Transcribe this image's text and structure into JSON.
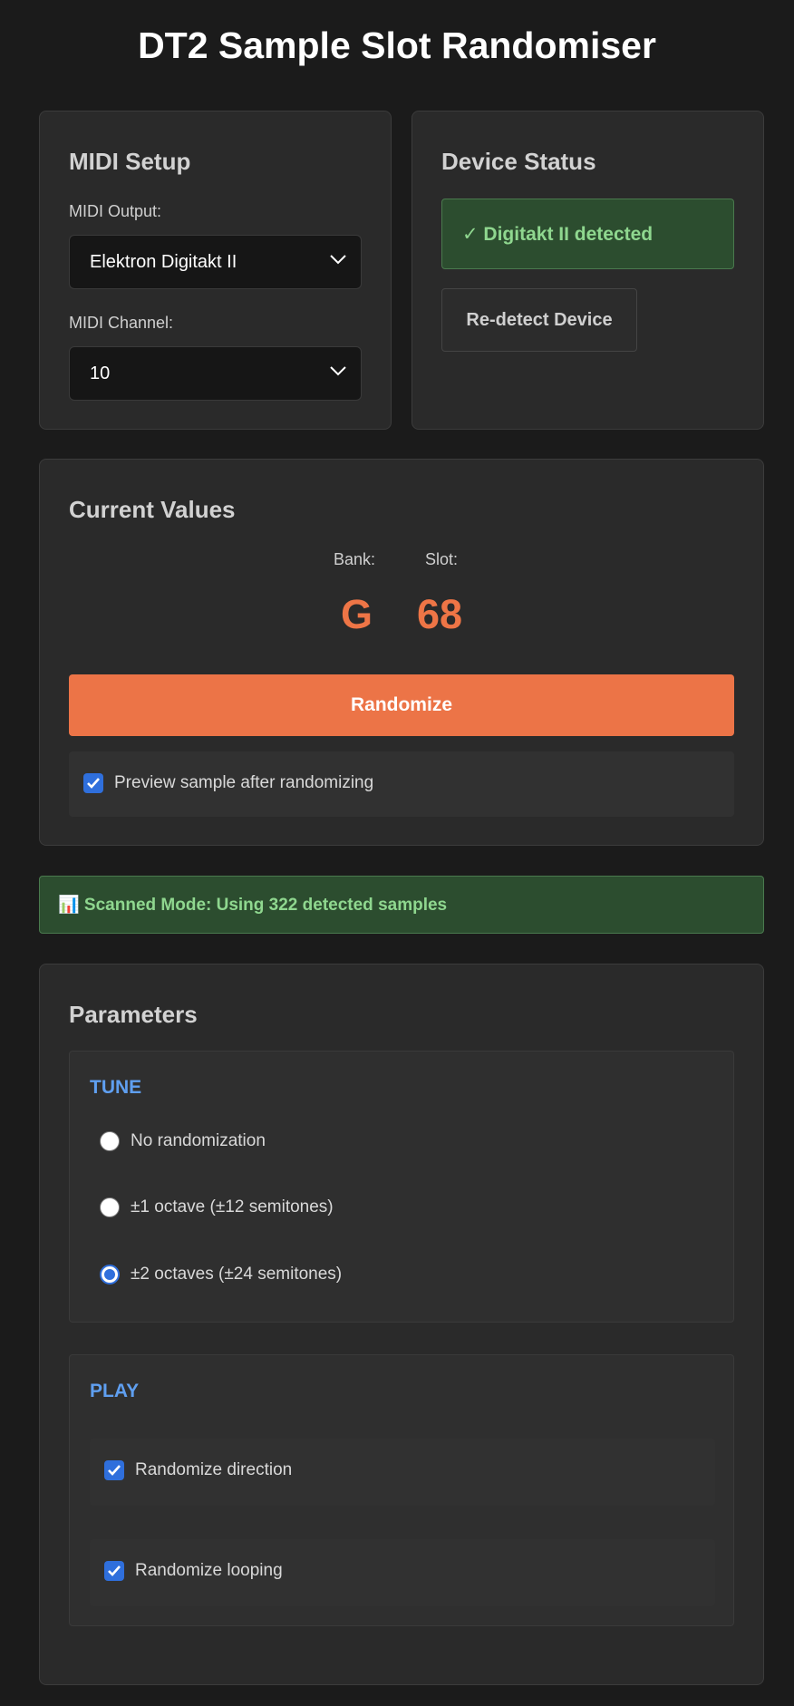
{
  "title": "DT2 Sample Slot Randomiser",
  "midi_setup": {
    "heading": "MIDI Setup",
    "output_label": "MIDI Output:",
    "output_value": "Elektron Digitakt II",
    "channel_label": "MIDI Channel:",
    "channel_value": "10"
  },
  "device_status": {
    "heading": "Device Status",
    "status_text": "✓ Digitakt II detected",
    "redetect_label": "Re-detect Device"
  },
  "current_values": {
    "heading": "Current Values",
    "bank_label": "Bank:",
    "slot_label": "Slot:",
    "bank_value": "G",
    "slot_value": "68",
    "randomize_label": "Randomize",
    "preview_label": "Preview sample after randomizing",
    "preview_checked": true
  },
  "scan_banner": "📊 Scanned Mode: Using 322 detected samples",
  "parameters": {
    "heading": "Parameters",
    "tune": {
      "title": "TUNE",
      "options": [
        {
          "label": "No randomization",
          "selected": false
        },
        {
          "label": "±1 octave (±12 semitones)",
          "selected": false
        },
        {
          "label": "±2 octaves (±24 semitones)",
          "selected": true
        }
      ]
    },
    "play": {
      "title": "PLAY",
      "options": [
        {
          "label": "Randomize direction",
          "checked": true
        },
        {
          "label": "Randomize looping",
          "checked": true
        }
      ]
    }
  },
  "colors": {
    "accent": "#ec7447",
    "success_bg": "#2c4d2f",
    "success_text": "#8fd78f",
    "section_title": "#5f9ff0",
    "checkbox": "#2f6fdc"
  }
}
